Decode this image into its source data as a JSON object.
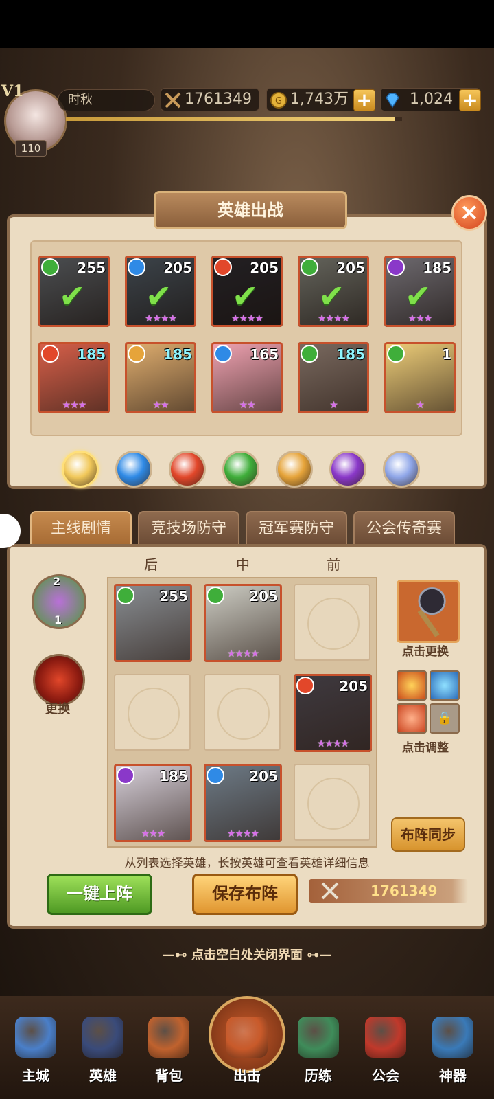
{
  "header": {
    "vip": "V1",
    "player_name": "时秋",
    "player_level": "110",
    "power": "1761349",
    "gold": "1,743万",
    "gems": "1,024",
    "plus": "+",
    "exp_fraction": 0.98
  },
  "panel": {
    "title": "英雄出战",
    "close": "×"
  },
  "hero_list": [
    {
      "level": "255",
      "element": "wind",
      "stars": "",
      "selected": true,
      "art": "#8a8f94"
    },
    {
      "level": "205",
      "element": "water",
      "stars": "★★★★",
      "selected": true,
      "art": "#6e7c88"
    },
    {
      "level": "205",
      "element": "fire",
      "stars": "★★★★",
      "selected": true,
      "art": "#3f3a40"
    },
    {
      "level": "205",
      "element": "wind",
      "stars": "★★★★",
      "selected": true,
      "art": "#b7b7a8"
    },
    {
      "level": "185",
      "element": "dark",
      "stars": "★★★",
      "selected": true,
      "art": "#c9c2cc"
    },
    {
      "level": "185",
      "element": "fire",
      "stars": "★★★",
      "selected": false,
      "art": "#d9604a"
    },
    {
      "level": "185",
      "element": "light",
      "stars": "★★",
      "selected": false,
      "art": "#e2b070"
    },
    {
      "level": "165",
      "element": "water",
      "stars": "★★",
      "selected": false,
      "art": "#f2a4b4"
    },
    {
      "level": "185",
      "element": "wind",
      "stars": "★",
      "selected": false,
      "art": "#7a6a60"
    },
    {
      "level": "1",
      "element": "wind",
      "stars": "★",
      "selected": false,
      "art": "#f0d07a"
    }
  ],
  "element_filters": [
    "all",
    "water",
    "fire",
    "wind",
    "light",
    "dark",
    "void"
  ],
  "tabs": [
    "主线剧情",
    "竞技场防守",
    "冠军赛防守",
    "公会传奇赛"
  ],
  "columns": {
    "back": "后",
    "mid": "中",
    "front": "前"
  },
  "formation": [
    {
      "level": "255",
      "element": "wind",
      "stars": "",
      "art": "#8a8f94"
    },
    {
      "level": "205",
      "element": "wind",
      "stars": "★★★★",
      "art": "#cfcfc6"
    },
    null,
    null,
    null,
    {
      "level": "205",
      "element": "fire",
      "stars": "★★★★",
      "art": "#3f3a40"
    },
    {
      "level": "185",
      "element": "dark",
      "stars": "★★★",
      "art": "#d9d2dc"
    },
    {
      "level": "205",
      "element": "water",
      "stars": "★★★★",
      "art": "#6e7c88"
    },
    null
  ],
  "side": {
    "swap_label": "更换",
    "counter_top": "2",
    "counter_bottom": "1",
    "weapon_label": "点击更换",
    "skill_label": "点击调整",
    "lock_icon": "🔒",
    "sync": "布阵同步"
  },
  "hint": "从列表选择英雄，长按英雄可查看英雄详细信息",
  "buttons": {
    "auto": "一键上阵",
    "save": "保存布阵"
  },
  "team_power": "1761349",
  "close_hint": "—⊷ 点击空白处关闭界面 ⊶—",
  "nav": [
    {
      "label": "主城",
      "color": "#4a7fc9"
    },
    {
      "label": "英雄",
      "color": "#3a4b7a"
    },
    {
      "label": "背包",
      "color": "#c0622e"
    },
    {
      "label": "出击",
      "color": "#c95a2a"
    },
    {
      "label": "历练",
      "color": "#3f8c5a"
    },
    {
      "label": "公会",
      "color": "#c0392b"
    },
    {
      "label": "神器",
      "color": "#3a7ab8"
    }
  ],
  "colors": {
    "water": "#2f8ae6",
    "fire": "#e2472a",
    "wind": "#3fae3a",
    "light": "#e6a43a",
    "dark": "#8a38c9",
    "void": "#8fa6e8",
    "all": "#f1c85a"
  }
}
